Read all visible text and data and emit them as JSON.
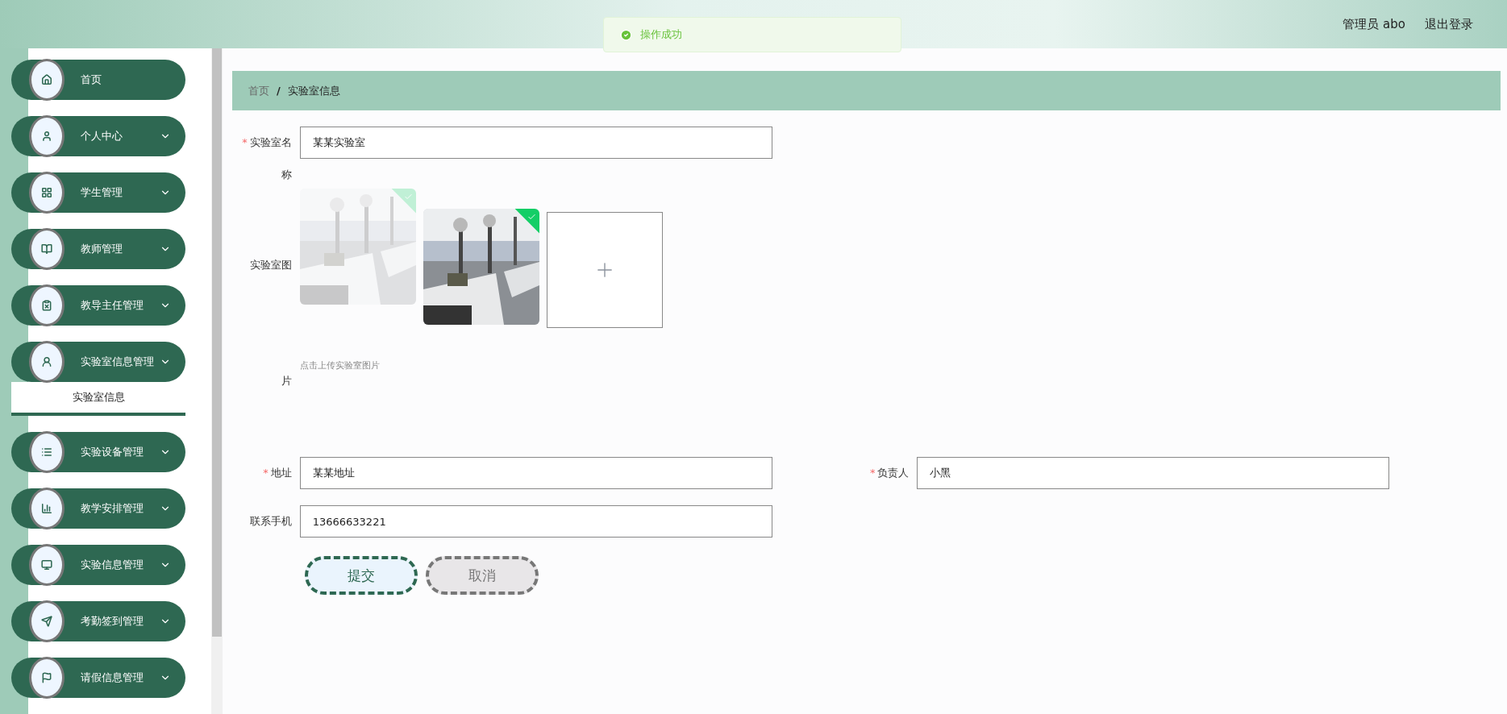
{
  "header": {
    "user": "管理员 abo",
    "logout": "退出登录"
  },
  "toast": {
    "message": "操作成功"
  },
  "sidebar": {
    "items": [
      {
        "label": "首页",
        "kind": "link"
      },
      {
        "label": "个人中心",
        "kind": "submenu"
      },
      {
        "label": "学生管理",
        "kind": "submenu"
      },
      {
        "label": "教师管理",
        "kind": "submenu"
      },
      {
        "label": "教导主任管理",
        "kind": "submenu"
      },
      {
        "label": "实验室信息管理",
        "kind": "submenu",
        "children": [
          {
            "label": "实验室信息",
            "selected": true
          }
        ]
      },
      {
        "label": "实验设备管理",
        "kind": "submenu"
      },
      {
        "label": "教学安排管理",
        "kind": "submenu"
      },
      {
        "label": "实验信息管理",
        "kind": "submenu"
      },
      {
        "label": "考勤签到管理",
        "kind": "submenu"
      },
      {
        "label": "请假信息管理",
        "kind": "submenu"
      }
    ]
  },
  "breadcrumb": [
    {
      "label": "首页",
      "current": false
    },
    {
      "label": "实验室信息",
      "current": true
    }
  ],
  "breadcrumb_separator": "/",
  "form": {
    "name": {
      "label": "实验室名称",
      "value": "某某实验室",
      "mark": "*"
    },
    "pictures": {
      "label": "实验室图片",
      "images": [
        {
          "kind": "picture",
          "uploaded": true,
          "faded": true
        },
        {
          "kind": "picture",
          "uploaded": true,
          "faded": false
        }
      ],
      "hint": "点击上传实验室图片"
    },
    "address": {
      "label": "地址",
      "value": "某某地址",
      "mark": "*"
    },
    "manager": {
      "label": "负责人",
      "value": "小黑",
      "mark": "*"
    },
    "phone": {
      "label": "联系手机",
      "value": "13666633221"
    },
    "buttons": [
      {
        "label": "提交",
        "kind": "primary"
      },
      {
        "label": "取消",
        "kind": "cancel"
      }
    ]
  }
}
